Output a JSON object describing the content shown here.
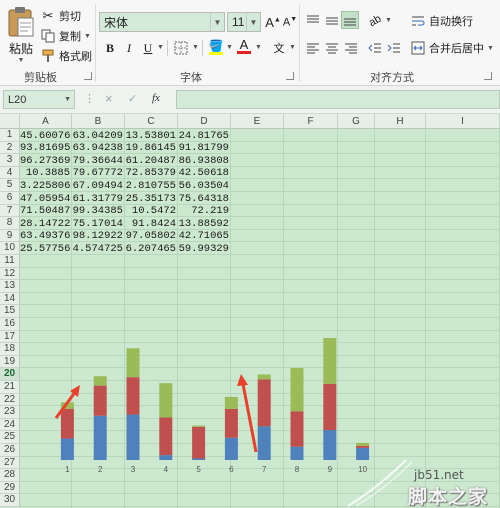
{
  "ribbon": {
    "clipboard": {
      "paste_label": "粘贴",
      "cut_label": "剪切",
      "copy_label": "复制",
      "format_painter_label": "格式刷",
      "group_label": "剪贴板"
    },
    "font": {
      "font_name": "宋体",
      "font_size": "11",
      "bold": "B",
      "italic": "I",
      "underline": "U",
      "grow": "A",
      "shrink": "A",
      "font_color_glyph": "A",
      "phonetic": "文",
      "group_label": "字体"
    },
    "alignment": {
      "wrap_text_label": "自动换行",
      "merge_center_label": "合并后居中",
      "group_label": "对齐方式"
    }
  },
  "formula_bar": {
    "name_box": "L20",
    "cancel": "×",
    "enter": "✓",
    "fx": "fx",
    "value": ""
  },
  "grid": {
    "columns": [
      "A",
      "B",
      "C",
      "D",
      "E",
      "F",
      "G",
      "H",
      "I"
    ],
    "rows": [
      "1",
      "2",
      "3",
      "4",
      "5",
      "6",
      "7",
      "8",
      "9",
      "10",
      "11",
      "12",
      "13",
      "14",
      "15",
      "16",
      "17",
      "18",
      "19",
      "20",
      "21",
      "22",
      "23",
      "24",
      "25",
      "26",
      "27",
      "28",
      "29",
      "30"
    ],
    "selected_row": "20",
    "cells": [
      [
        "45.60076",
        "63.04209",
        "13.53801",
        "24.81765"
      ],
      [
        "93.81695",
        "63.94238",
        "19.86145",
        "91.81799"
      ],
      [
        "96.27369",
        "79.36644",
        "61.20487",
        "86.93808"
      ],
      [
        "10.3885",
        "79.67772",
        "72.85379",
        "42.50618"
      ],
      [
        "3.225806",
        "67.09494",
        "2.810755",
        "56.03504"
      ],
      [
        "47.05954",
        "61.31779",
        "25.35173",
        "75.64318"
      ],
      [
        "71.50487",
        "99.34385",
        "10.5472",
        "72.219"
      ],
      [
        "28.14722",
        "75.17014",
        "91.8424",
        "13.88592"
      ],
      [
        "63.49376",
        "98.12922",
        "97.05802",
        "42.71065"
      ],
      [
        "25.57756",
        "4.574725",
        "6.207465",
        "59.99329"
      ]
    ]
  },
  "chart_data": {
    "type": "bar",
    "stacked": true,
    "categories": [
      "1",
      "2",
      "3",
      "4",
      "5",
      "6",
      "7",
      "8",
      "9",
      "10"
    ],
    "series": [
      {
        "values": [
          45.60076,
          93.81695,
          96.27369,
          10.3885,
          3.225806,
          47.05954,
          71.50487,
          28.14722,
          63.49376,
          25.57756
        ]
      },
      {
        "values": [
          63.04209,
          63.94238,
          79.36644,
          79.67772,
          67.09494,
          61.31779,
          99.34385,
          75.17014,
          98.12922,
          4.574725
        ]
      },
      {
        "values": [
          13.53801,
          19.86145,
          61.20487,
          72.85379,
          2.810755,
          25.35173,
          10.5472,
          91.8424,
          97.05802,
          6.207465
        ]
      }
    ],
    "colors": [
      "#4f81bd",
      "#c0504d",
      "#9bbb59"
    ],
    "legend": "none"
  },
  "watermark": {
    "site": "jb51.net",
    "brand": "脚本之家"
  },
  "colors": {
    "grid_bg": "#cce8cf",
    "arrow": "#e8402a",
    "accent_green": "#217346"
  }
}
